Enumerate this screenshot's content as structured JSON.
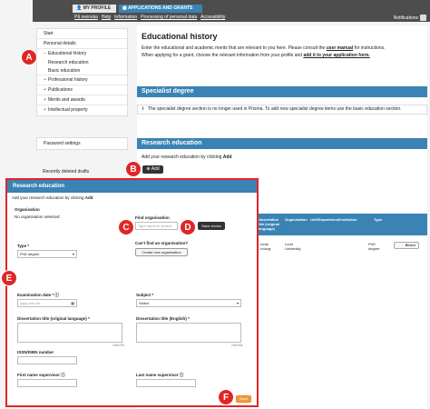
{
  "topnav": {
    "tab_profile": "MY PROFILE",
    "tab_apps": "APPLICATIONS AND GRANTS",
    "links": [
      "På svenska",
      "Help",
      "Information",
      "Processing of personal data",
      "Accessibility"
    ],
    "notifications": "Notifications"
  },
  "sidebar": {
    "items": [
      "Start",
      "Personal details",
      "Educational history",
      "Research education",
      "Basic education",
      "Professional history",
      "Publications",
      "Merits and awards",
      "Intellectual property"
    ],
    "password": "Password settings",
    "drafts": "Recently deleted drafts"
  },
  "main": {
    "title": "Educational history",
    "intro1_a": "Enter the educational and academic merits that are relevant to you here. Please consult the ",
    "intro1_link": "user manual",
    "intro1_b": " for instructions.",
    "intro2_a": "When applying for a grant, choose the relevant information from your profile and ",
    "intro2_link": "add it to your application form.",
    "specialist_title": "Specialist degree",
    "specialist_info": "The specialist degree section is no longer used in Prisma. To add new specialist degree items use the basic education section.",
    "research_title": "Research education",
    "research_text_a": "Add your research education by clicking ",
    "research_text_b": "Add",
    "add_label": "Add",
    "table_headers": [
      "Dissertation title (original language)",
      "Organisation",
      "Unit/Department/Institution",
      "Type"
    ],
    "row": {
      "title": "...ional ...inolog",
      "org": "Lund University",
      "type": "PhD degree",
      "select": "Select"
    }
  },
  "modal": {
    "title": "Research education",
    "intro_a": "Add your research education by clicking ",
    "intro_b": "Add",
    "org_label": "Organisation",
    "org_value": "No organisation selected",
    "find_label": "Find organisation",
    "find_placeholder": "Type name to search",
    "save_choice": "Save choice",
    "cant_find": "Can't find an organisation?",
    "create_org": "Create new organisation",
    "type_label": "Type",
    "type_value": "PhD degree",
    "exam_label": "Examination date",
    "exam_placeholder": "yyyy-mm-dd",
    "subject_label": "Subject",
    "subject_value": "Select",
    "diss_orig_label": "Dissertation title (original language)",
    "diss_en_label": "Dissertation title (English)",
    "char_count": "256/256",
    "isbn_label": "ISSN/ISBN number",
    "first_sup_label": "First name supervisor",
    "last_sup_label": "Last name supervisor",
    "save": "Save"
  },
  "callouts": {
    "a": "A",
    "b": "B",
    "c": "C",
    "d": "D",
    "e": "E",
    "f": "F"
  },
  "colors": {
    "accent": "#3a83b4",
    "callout": "#e02626"
  }
}
